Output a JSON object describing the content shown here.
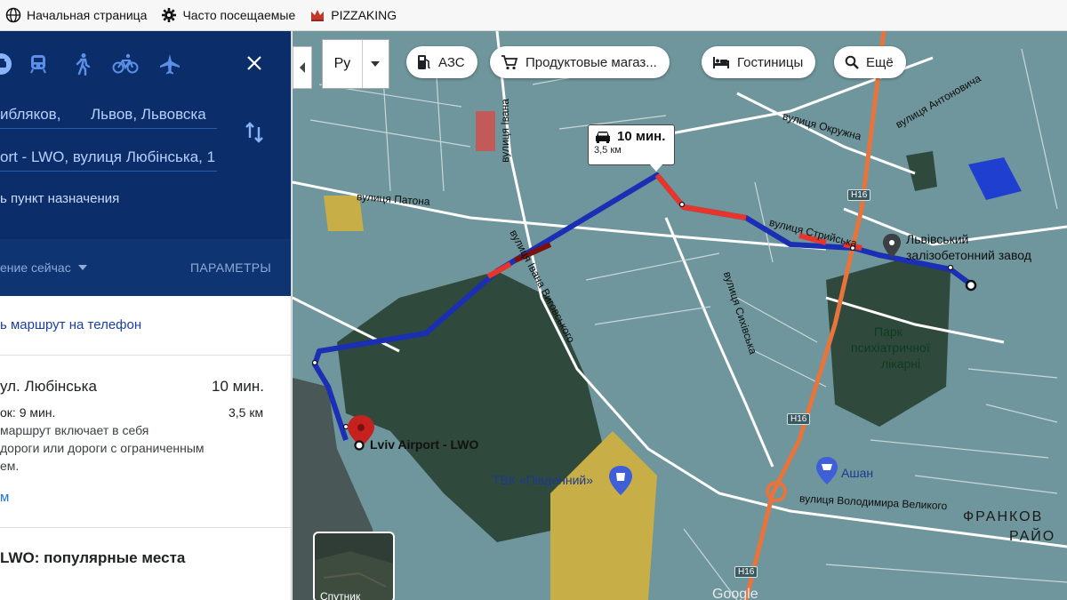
{
  "bookmarks": [
    {
      "label": "Начальная страница",
      "icon": "globe-icon"
    },
    {
      "label": "Часто посещаемые",
      "icon": "gear-icon"
    },
    {
      "label": "PIZZAKING",
      "icon": "crown-icon"
    }
  ],
  "panel": {
    "origin_part1": "ибляков,",
    "origin_part2": "Львов, Львовска",
    "destination": "ort - LWO, вулиця Любінська, 1",
    "add_destination": "ь пункт назначения",
    "depart": "ение сейчас",
    "params": "ПАРАМЕТРЫ",
    "send_to_phone": "ь маршрут на телефон",
    "route": {
      "title": "ул. Любінська",
      "time": "10 мин.",
      "sub": "ок: 9 мин.",
      "distance": "3,5 км",
      "line1": "маршрут включает в себя",
      "line2": "дороги или дороги с ограниченным",
      "line3": "ем.",
      "more": "м"
    },
    "popular": "LWO: популярные места"
  },
  "map": {
    "lang": "Ру",
    "chips": [
      "АЗС",
      "Продуктовые магаз...",
      "Гостиницы",
      "Ещё"
    ],
    "callout_time": "10 мин.",
    "callout_dist": "3,5 км",
    "labels": {
      "patona": "вулиця Патона",
      "okruzhna": "вулиця Окружна",
      "antonovycha": "вулиця Антоновича",
      "ivana": "вулиця Івана",
      "vyhovskoho": "вулиця Івана Виговського",
      "shevchenka": "вулиця Сихівська",
      "stryiska": "вулиця Стрийська",
      "zavod1": "Львівський",
      "zavod2": "залізобетонний завод",
      "park1": "Парк",
      "park2": "психіатричної",
      "park3": "лікарні",
      "airport": "Lviv Airport - LWO",
      "mall": "ТВК «Південний»",
      "ashan": "Ашан",
      "volodymyra": "вулиця Володимира Великого",
      "frankiv1": "ФРАНКОВ",
      "frankiv2": "РАЙО",
      "road1": "Н16",
      "road2": "Н16",
      "road3": "Н16",
      "satellite": "Спутник",
      "google": "Google"
    }
  }
}
